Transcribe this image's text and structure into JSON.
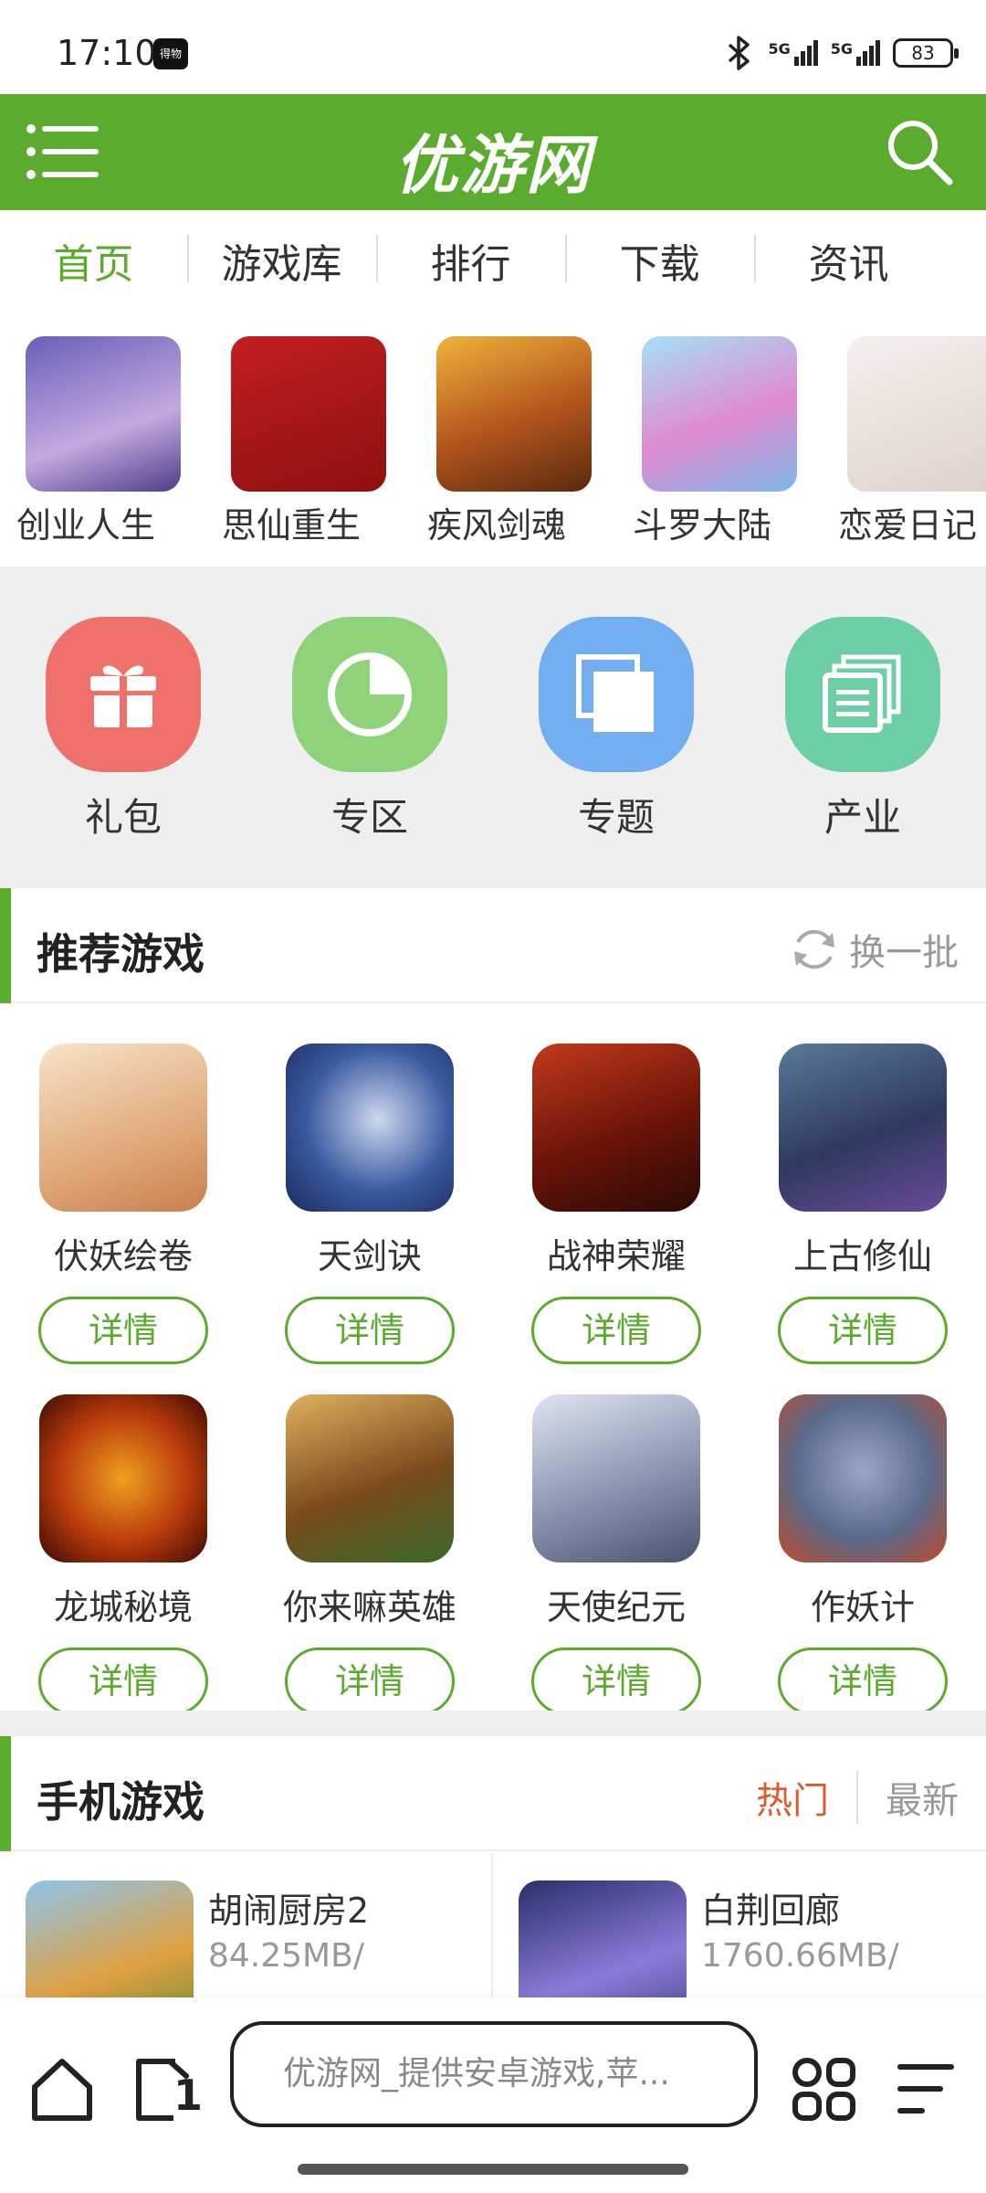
{
  "status": {
    "time": "17:10",
    "app_badge": "得物",
    "network1": "5G",
    "network2": "5G",
    "battery": "83"
  },
  "header": {
    "logo": "优游网",
    "menu_icon": "menu-icon",
    "search_icon": "search-icon",
    "brand_color": "#5aab2e"
  },
  "tabs": [
    {
      "label": "首页"
    },
    {
      "label": "游戏库"
    },
    {
      "label": "排行"
    },
    {
      "label": "下载"
    },
    {
      "label": "资讯"
    }
  ],
  "top_games": [
    {
      "name": "创业人生",
      "color": "#8a7fc8"
    },
    {
      "name": "思仙重生",
      "color": "#b31b1b"
    },
    {
      "name": "疾风剑魂",
      "color": "#d28a2a"
    },
    {
      "name": "斗罗大陆",
      "color": "#7fc0e8"
    },
    {
      "name": "恋爱日记",
      "color": "#e8e2de"
    }
  ],
  "categories": [
    {
      "label": "礼包",
      "icon": "gift-icon",
      "color": "#ef716c"
    },
    {
      "label": "专区",
      "icon": "pie-chart-icon",
      "color": "#8ed27a"
    },
    {
      "label": "专题",
      "icon": "stacked-squares-icon",
      "color": "#72aef0"
    },
    {
      "label": "产业",
      "icon": "documents-icon",
      "color": "#6dcfa6"
    }
  ],
  "recommended": {
    "title": "推荐游戏",
    "refresh_label": "换一批",
    "detail_label": "详情",
    "games": [
      {
        "name": "伏妖绘卷",
        "color": "#e9c9a4"
      },
      {
        "name": "天剑诀",
        "color": "#2f4d8a"
      },
      {
        "name": "战神荣耀",
        "color": "#8a2216"
      },
      {
        "name": "上古修仙",
        "color": "#3c4a6e"
      },
      {
        "name": "龙城秘境",
        "color": "#7a1c0e"
      },
      {
        "name": "你来嘛英雄",
        "color": "#9a6a2a"
      },
      {
        "name": "天使纪元",
        "color": "#9aa2b8"
      },
      {
        "name": "作妖计",
        "color": "#5a6a8a"
      }
    ]
  },
  "mobile_games": {
    "title": "手机游戏",
    "sort_hot": "热门",
    "sort_new": "最新",
    "items": [
      {
        "name": "胡闹厨房2",
        "size": "84.25MB/",
        "color": "#6aa6d8"
      },
      {
        "name": "白荆回廊",
        "size": "1760.66MB/",
        "color": "#3a3f7a"
      }
    ]
  },
  "bottom_bar": {
    "url_text": "优游网_提供安卓游戏,苹...",
    "home_icon": "home-icon",
    "tabs_icon": "tabs-count-icon",
    "tabs_count": "1",
    "apps_icon": "grid-icon",
    "menu_icon": "menu-lines-icon"
  }
}
